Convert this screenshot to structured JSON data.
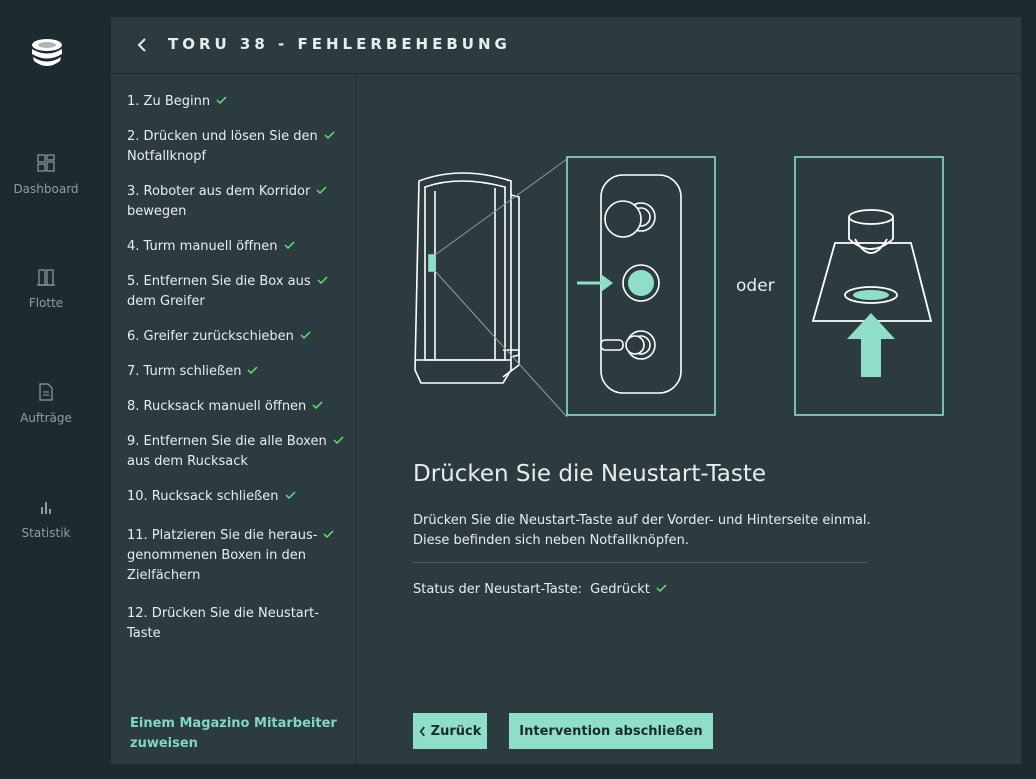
{
  "nav": {
    "items": [
      {
        "label": "Dashboard",
        "icon": "dashboard-icon"
      },
      {
        "label": "Flotte",
        "icon": "fleet-icon"
      },
      {
        "label": "Aufträge",
        "icon": "orders-icon"
      },
      {
        "label": "Statistik",
        "icon": "statistics-icon"
      }
    ]
  },
  "header": {
    "title": "TORU 38 - FEHLERBEHEBUNG"
  },
  "steps": [
    {
      "line1": "1. Zu Beginn",
      "line2": "",
      "line3": "",
      "done": true
    },
    {
      "line1": "2. Drücken und lösen Sie den",
      "line2": "Notfallknopf",
      "line3": "",
      "done": true
    },
    {
      "line1": "3. Roboter aus dem Korridor",
      "line2": "bewegen",
      "line3": "",
      "done": true
    },
    {
      "line1": "4. Turm manuell öffnen",
      "line2": "",
      "line3": "",
      "done": true
    },
    {
      "line1": "5. Entfernen Sie die Box aus",
      "line2": "dem Greifer",
      "line3": "",
      "done": true
    },
    {
      "line1": "6. Greifer zurückschieben",
      "line2": "",
      "line3": "",
      "done": true
    },
    {
      "line1": "7. Turm schließen",
      "line2": "",
      "line3": "",
      "done": true
    },
    {
      "line1": "8. Rucksack manuell öffnen",
      "line2": "",
      "line3": "",
      "done": true
    },
    {
      "line1": "9. Entfernen Sie die alle Boxen",
      "line2": "aus dem Rucksack",
      "line3": "",
      "done": true
    },
    {
      "line1": "10. Rucksack schließen",
      "line2": "",
      "line3": "",
      "done": true
    },
    {
      "line1": "11. Platzieren Sie die heraus-",
      "line2": "genommenen Boxen in den",
      "line3": "Zielfächern",
      "done": true
    },
    {
      "line1": "12. Drücken Sie die Neustart-",
      "line2": "Taste",
      "line3": "",
      "done": false
    }
  ],
  "assign": {
    "line1": "Einem Magazino Mitarbeiter",
    "line2": "zuweisen"
  },
  "main": {
    "oder": "oder",
    "heading": "Drücken Sie die Neustart-Taste",
    "desc_line1": "Drücken Sie die Neustart-Taste auf der Vorder- und Hinterseite einmal.",
    "desc_line2": "Diese befinden sich neben Notfallknöpfen.",
    "status_label": "Status der Neustart-Taste:",
    "status_value": "Gedrückt"
  },
  "buttons": {
    "back": "Zurück",
    "finish": "Intervention abschließen"
  },
  "colors": {
    "accent": "#8fdfc8",
    "check": "#5fe07a",
    "panel": "#2b3b3f",
    "background": "#1e2b2e"
  }
}
